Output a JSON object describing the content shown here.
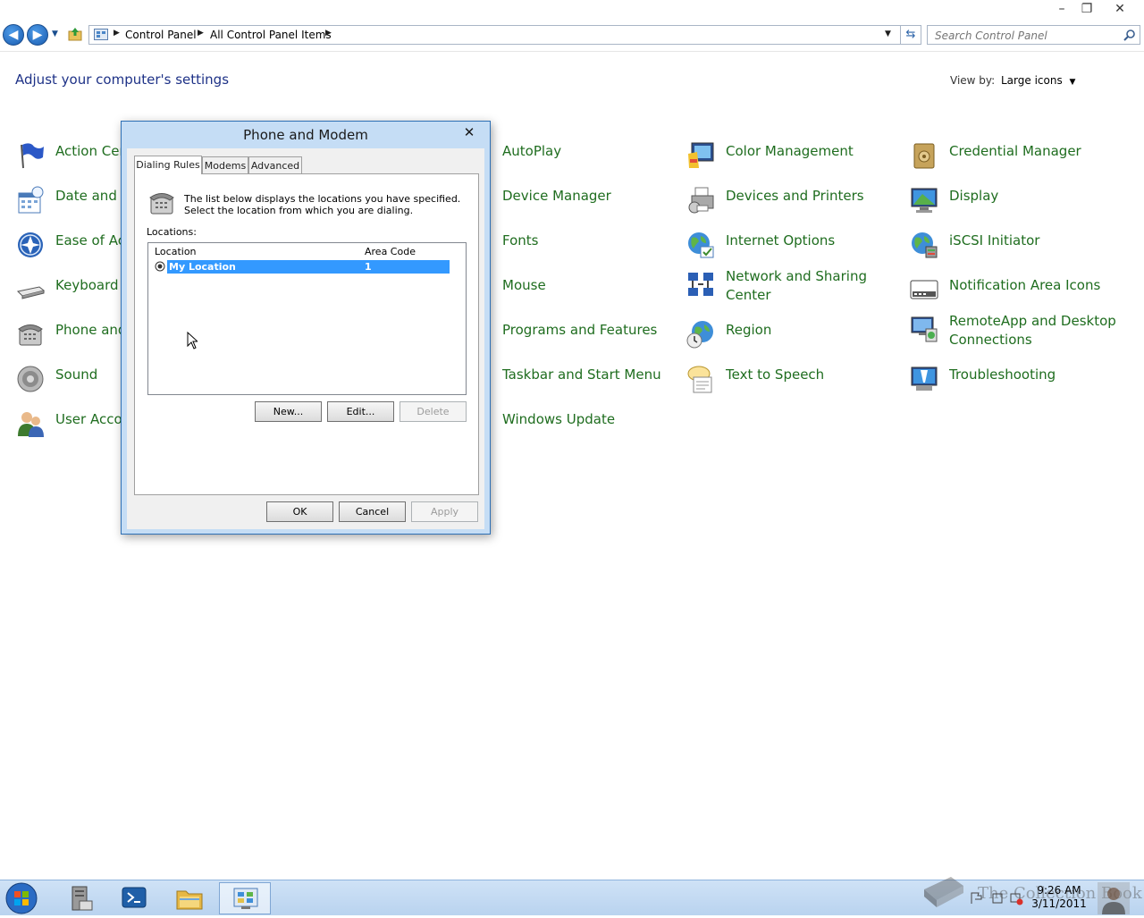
{
  "window": {
    "minimize": "–",
    "maximize": "❐",
    "close": "✕"
  },
  "breadcrumb": [
    "Control Panel",
    "All Control Panel Items"
  ],
  "search": {
    "placeholder": "Search Control Panel"
  },
  "header": {
    "title": "Adjust your computer's settings",
    "view_by_label": "View by:",
    "view_by_value": "Large icons"
  },
  "items": [
    {
      "label": "Action Cen",
      "icon": "flag-icon"
    },
    {
      "label": "Date and T",
      "icon": "calendar-clock-icon"
    },
    {
      "label": "Ease of Acc",
      "icon": "ease-of-access-icon"
    },
    {
      "label": "Keyboard",
      "icon": "keyboard-icon"
    },
    {
      "label": "Phone and",
      "icon": "phone-modem-icon"
    },
    {
      "label": "Sound",
      "icon": "speaker-icon"
    },
    {
      "label": "User Accou",
      "icon": "users-icon"
    },
    {
      "label": "AutoPlay",
      "icon": "autoplay-icon"
    },
    {
      "label": "Device Manager",
      "icon": "device-manager-icon"
    },
    {
      "label": "Fonts",
      "icon": "fonts-icon"
    },
    {
      "label": "Mouse",
      "icon": "mouse-icon"
    },
    {
      "label": "Programs and Features",
      "icon": "programs-icon"
    },
    {
      "label": "Taskbar and Start Menu",
      "icon": "taskbar-icon"
    },
    {
      "label": "Windows Update",
      "icon": "windows-update-icon"
    },
    {
      "label": "Color Management",
      "icon": "color-management-icon"
    },
    {
      "label": "Devices and Printers",
      "icon": "printer-icon"
    },
    {
      "label": "Internet Options",
      "icon": "globe-icon"
    },
    {
      "label": "Network and Sharing Center",
      "icon": "network-icon"
    },
    {
      "label": "Region",
      "icon": "region-globe-icon"
    },
    {
      "label": "Text to Speech",
      "icon": "speech-bubble-icon"
    },
    {
      "label": "Credential Manager",
      "icon": "credential-vault-icon"
    },
    {
      "label": "Display",
      "icon": "monitor-icon"
    },
    {
      "label": "iSCSI Initiator",
      "icon": "iscsi-globe-icon"
    },
    {
      "label": "Notification Area Icons",
      "icon": "notification-area-icon"
    },
    {
      "label": "RemoteApp and Desktop Connections",
      "icon": "remoteapp-icon"
    },
    {
      "label": "Troubleshooting",
      "icon": "troubleshooting-icon"
    }
  ],
  "dialog": {
    "title": "Phone and Modem",
    "tabs": [
      "Dialing Rules",
      "Modems",
      "Advanced"
    ],
    "description": "The list below displays the locations you have specified. Select the location from which you are dialing.",
    "locations_label": "Locations:",
    "columns": [
      "Location",
      "Area Code"
    ],
    "rows": [
      {
        "location": "My Location",
        "area_code": "1"
      }
    ],
    "buttons": {
      "new": "New...",
      "edit": "Edit...",
      "delete": "Delete",
      "ok": "OK",
      "cancel": "Cancel",
      "apply": "Apply"
    }
  },
  "taskbar": {
    "time": "9:26 AM",
    "date": "3/11/2011",
    "watermark": "The Collection Book"
  },
  "colors": {
    "link_green": "#1f6d1f",
    "title_blue": "#1e3287",
    "selection": "#3399ff"
  }
}
